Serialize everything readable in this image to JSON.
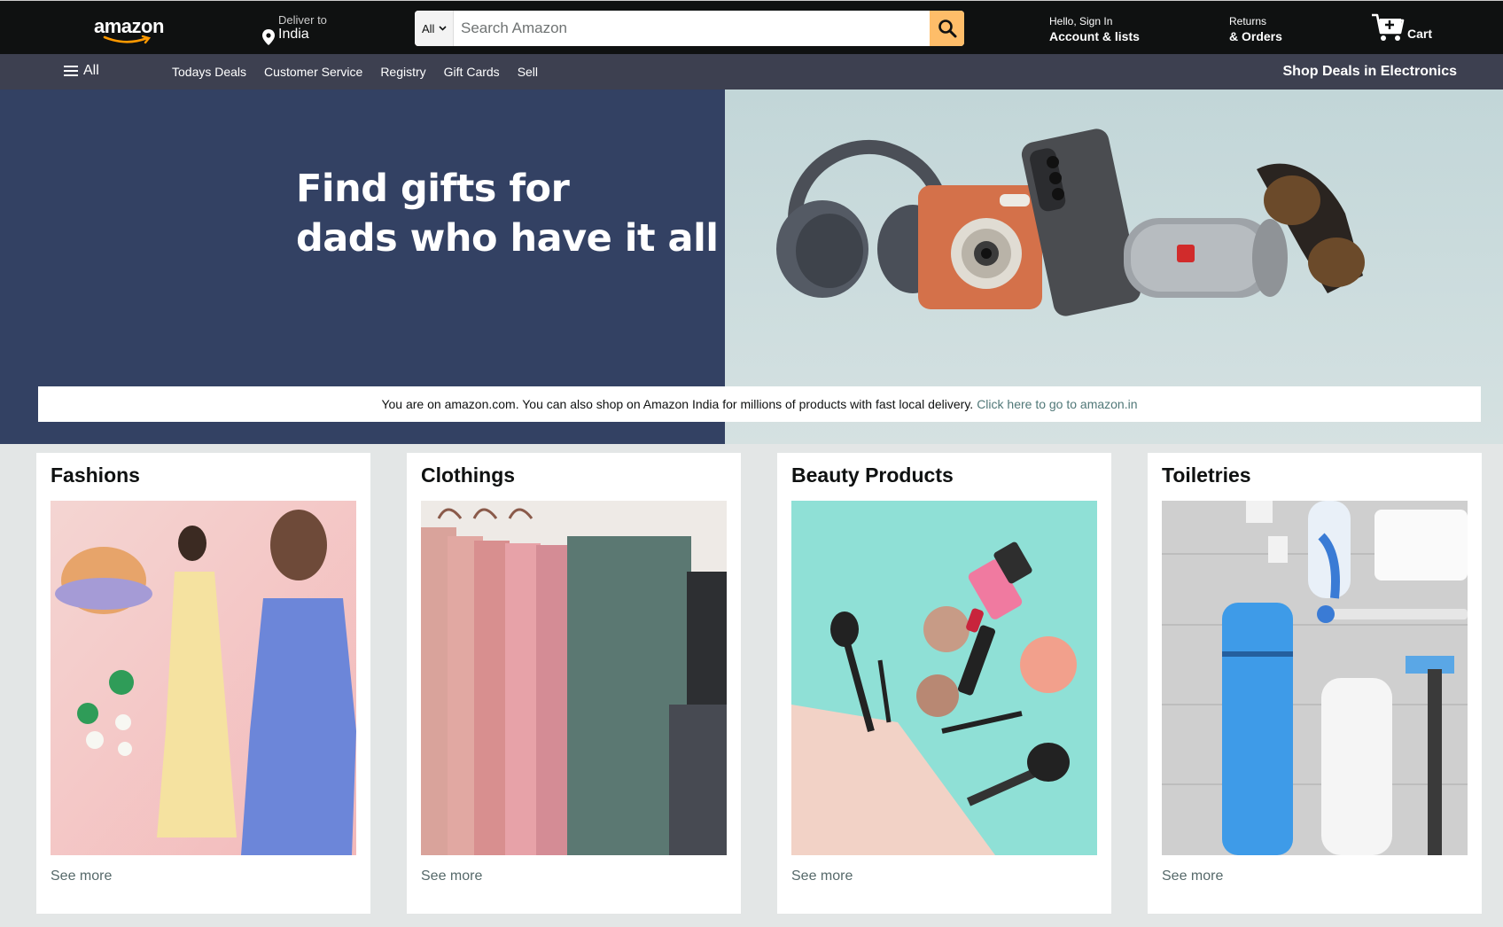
{
  "header": {
    "logo_text": "amazon",
    "deliver": {
      "label": "Deliver to",
      "location": "India"
    },
    "search": {
      "category": "All",
      "placeholder": "Search Amazon"
    },
    "account": {
      "greeting": "Hello, Sign In",
      "label": "Account & lists"
    },
    "returns": {
      "line1": "Returns",
      "line2": "& Orders"
    },
    "cart": {
      "label": "Cart",
      "count": ""
    }
  },
  "subnav": {
    "all_label": "All",
    "links": [
      "Todays Deals",
      "Customer Service",
      "Registry",
      "Gift Cards",
      "Sell"
    ],
    "promo": "Shop Deals in Electronics"
  },
  "hero": {
    "line1": "Find gifts for",
    "line2": "dads who have it all",
    "colors": {
      "left": "#334163",
      "right": "#c9dadb"
    }
  },
  "notice": {
    "text": "You are on amazon.com. You can also shop on Amazon India for millions of products with fast local delivery.",
    "link": "Click here to go to amazon.in"
  },
  "cards": [
    {
      "title": "Fashions",
      "link": "See more"
    },
    {
      "title": "Clothings",
      "link": "See more"
    },
    {
      "title": "Beauty Products",
      "link": "See more"
    },
    {
      "title": "Toiletries",
      "link": "See more"
    }
  ],
  "colors": {
    "nav_dark": "#0f1111",
    "nav_sub": "#3d4050",
    "search_button": "#febd69",
    "smile_orange": "#ff9900",
    "page_bg": "#e3e6e6",
    "link_teal": "#517878"
  }
}
